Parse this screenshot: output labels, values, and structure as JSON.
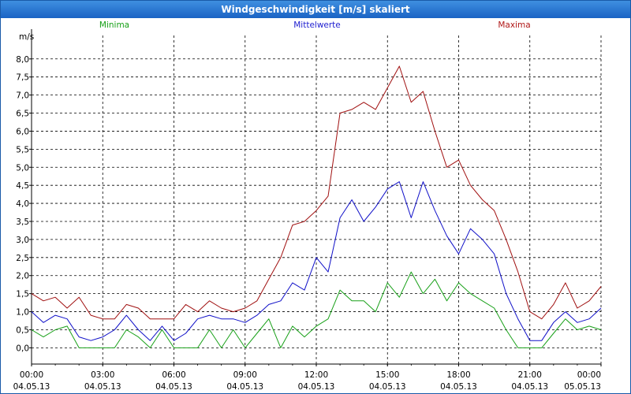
{
  "window": {
    "title": "Windgeschwindigkeit [m/s] skaliert"
  },
  "colors": {
    "minima": "#18a018",
    "mittelwerte": "#1010c8",
    "maxima": "#a01010",
    "grid": "#000000"
  },
  "chart_data": {
    "type": "line",
    "title": "Windgeschwindigkeit [m/s] skaliert",
    "ylabel": "m/s",
    "xlabel": "",
    "ylim": [
      -0.45,
      8.65
    ],
    "xlim": [
      0,
      24
    ],
    "grid": true,
    "y_ticks": [
      "0,0",
      "0,5",
      "1,0",
      "1,5",
      "2,0",
      "2,5",
      "3,0",
      "3,5",
      "4,0",
      "4,5",
      "5,0",
      "5,5",
      "6,0",
      "6,5",
      "7,0",
      "7,5",
      "8,0"
    ],
    "y_tick_values": [
      0,
      0.5,
      1,
      1.5,
      2,
      2.5,
      3,
      3.5,
      4,
      4.5,
      5,
      5.5,
      6,
      6.5,
      7,
      7.5,
      8
    ],
    "x_ticks": [
      {
        "time": "00:00",
        "date": "04.05.13"
      },
      {
        "time": "03:00",
        "date": "04.05.13"
      },
      {
        "time": "06:00",
        "date": "04.05.13"
      },
      {
        "time": "09:00",
        "date": "04.05.13"
      },
      {
        "time": "12:00",
        "date": "04.05.13"
      },
      {
        "time": "15:00",
        "date": "04.05.13"
      },
      {
        "time": "18:00",
        "date": "04.05.13"
      },
      {
        "time": "21:00",
        "date": "04.05.13"
      },
      {
        "time": "00:00",
        "date": "05.05.13"
      }
    ],
    "legend": [
      "Minima",
      "Mittelwerte",
      "Maxima"
    ],
    "legend_placement": "top",
    "series": [
      {
        "name": "Minima",
        "x": [
          0,
          0.5,
          1,
          1.5,
          2,
          2.5,
          3,
          3.5,
          4,
          4.5,
          5,
          5.5,
          6,
          6.5,
          7,
          7.5,
          8,
          8.5,
          9,
          9.5,
          10,
          10.5,
          11,
          11.5,
          12,
          12.5,
          13,
          13.5,
          14,
          14.5,
          15,
          15.5,
          16,
          16.5,
          17,
          17.5,
          18,
          18.5,
          19,
          19.5,
          20,
          20.5,
          21,
          21.5,
          22,
          22.5,
          23,
          23.5,
          24
        ],
        "values": [
          0.5,
          0.3,
          0.5,
          0.6,
          0.0,
          0.0,
          0.0,
          0.0,
          0.5,
          0.3,
          0.0,
          0.5,
          0.0,
          0.0,
          0.0,
          0.5,
          0.0,
          0.5,
          0.0,
          0.4,
          0.8,
          0.0,
          0.6,
          0.3,
          0.6,
          0.8,
          1.6,
          1.3,
          1.3,
          1.0,
          1.8,
          1.4,
          2.1,
          1.5,
          1.9,
          1.3,
          1.8,
          1.5,
          1.3,
          1.1,
          0.5,
          0.0,
          0.0,
          0.0,
          0.4,
          0.8,
          0.5,
          0.6,
          0.5
        ]
      },
      {
        "name": "Mittelwerte",
        "x": [
          0,
          0.5,
          1,
          1.5,
          2,
          2.5,
          3,
          3.5,
          4,
          4.5,
          5,
          5.5,
          6,
          6.5,
          7,
          7.5,
          8,
          8.5,
          9,
          9.5,
          10,
          10.5,
          11,
          11.5,
          12,
          12.5,
          13,
          13.5,
          14,
          14.5,
          15,
          15.5,
          16,
          16.5,
          17,
          17.5,
          18,
          18.5,
          19,
          19.5,
          20,
          20.5,
          21,
          21.5,
          22,
          22.5,
          23,
          23.5,
          24
        ],
        "values": [
          1.0,
          0.7,
          0.9,
          0.8,
          0.3,
          0.2,
          0.3,
          0.5,
          0.9,
          0.5,
          0.2,
          0.6,
          0.2,
          0.4,
          0.8,
          0.9,
          0.8,
          0.8,
          0.7,
          0.9,
          1.2,
          1.3,
          1.8,
          1.6,
          2.5,
          2.1,
          3.6,
          4.1,
          3.5,
          3.9,
          4.4,
          4.6,
          3.6,
          4.6,
          3.8,
          3.1,
          2.6,
          3.3,
          3.0,
          2.6,
          1.5,
          0.8,
          0.2,
          0.2,
          0.7,
          1.0,
          0.7,
          0.8,
          1.1
        ]
      },
      {
        "name": "Maxima",
        "x": [
          0,
          0.5,
          1,
          1.5,
          2,
          2.5,
          3,
          3.5,
          4,
          4.5,
          5,
          5.5,
          6,
          6.5,
          7,
          7.5,
          8,
          8.5,
          9,
          9.5,
          10,
          10.5,
          11,
          11.5,
          12,
          12.5,
          13,
          13.5,
          14,
          14.5,
          15,
          15.5,
          16,
          16.5,
          17,
          17.5,
          18,
          18.5,
          19,
          19.5,
          20,
          20.5,
          21,
          21.5,
          22,
          22.5,
          23,
          23.5,
          24
        ],
        "values": [
          1.5,
          1.3,
          1.4,
          1.1,
          1.4,
          0.9,
          0.8,
          0.8,
          1.2,
          1.1,
          0.8,
          0.8,
          0.8,
          1.2,
          1.0,
          1.3,
          1.1,
          1.0,
          1.1,
          1.3,
          1.9,
          2.5,
          3.4,
          3.5,
          3.8,
          4.2,
          6.5,
          6.6,
          6.8,
          6.6,
          7.2,
          7.8,
          6.8,
          7.1,
          6.0,
          5.0,
          5.2,
          4.5,
          4.1,
          3.8,
          3.0,
          2.1,
          1.0,
          0.8,
          1.2,
          1.8,
          1.1,
          1.3,
          1.7
        ]
      }
    ]
  }
}
